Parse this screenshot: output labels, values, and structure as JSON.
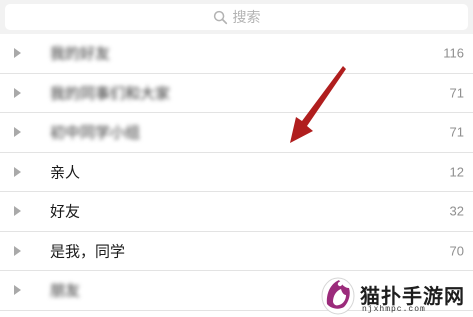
{
  "search": {
    "placeholder": "搜索",
    "icon": "search-icon"
  },
  "groups": [
    {
      "name": "我的好友",
      "count": "116",
      "blurred": true
    },
    {
      "name": "我的同事们和大家",
      "count": "71",
      "blurred": true
    },
    {
      "name": "初中同学小组",
      "count": "71",
      "blurred": true
    },
    {
      "name": "亲人",
      "count": "12",
      "blurred": false
    },
    {
      "name": "好友",
      "count": "32",
      "blurred": false
    },
    {
      "name": "是我，同学",
      "count": "70",
      "blurred": false
    },
    {
      "name": "朋友",
      "count": "",
      "blurred": true
    }
  ],
  "annotation": {
    "arrow_color": "#b01e1e"
  },
  "watermark": {
    "title": "猫扑手游网",
    "url": "njxhmpc.com"
  }
}
